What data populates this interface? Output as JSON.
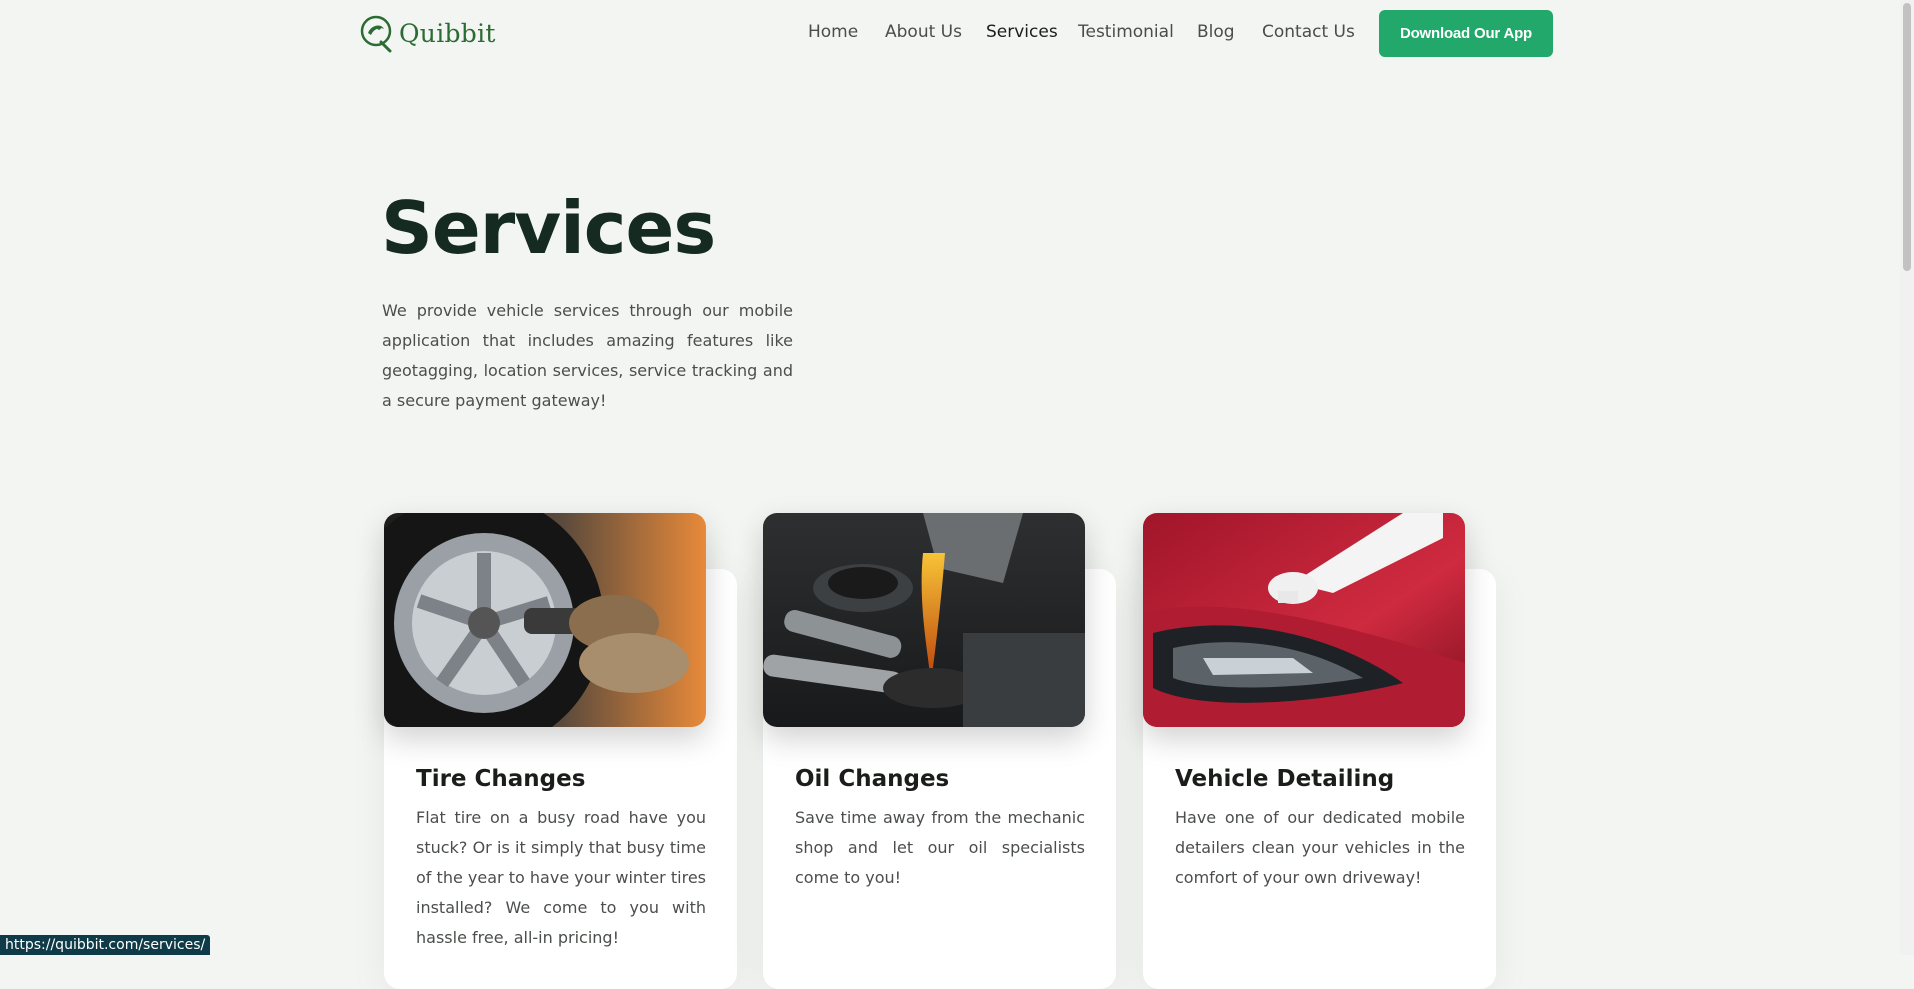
{
  "brand": {
    "name": "Quibbit",
    "color": "#2b6b34"
  },
  "nav": {
    "items": [
      "Home",
      "About Us",
      "Services",
      "Testimonial",
      "Blog",
      "Contact Us"
    ],
    "active": "Services"
  },
  "cta": {
    "label": "Download Our App",
    "color": "#22a86a"
  },
  "hero": {
    "title": "Services",
    "text": "We provide vehicle services through our mobile application that includes amazing features like geotagging, location services, service tracking and a secure payment gateway!"
  },
  "cards": [
    {
      "title": "Tire Changes",
      "text": "Flat tire on a busy road have you stuck? Or is it simply that busy time of the year to have your winter tires installed? We come to you with hassle free, all-in pricing!",
      "image": "tire-change-photo"
    },
    {
      "title": "Oil Changes",
      "text": "Save time away from the mechanic shop and let our oil specialists come to you!",
      "image": "oil-change-photo"
    },
    {
      "title": "Vehicle Detailing",
      "text": "Have one of our dedicated mobile detailers clean your vehicles in the comfort of your own driveway!",
      "image": "vehicle-detailing-photo"
    }
  ],
  "status": {
    "url": "https://quibbit.com/services/"
  }
}
